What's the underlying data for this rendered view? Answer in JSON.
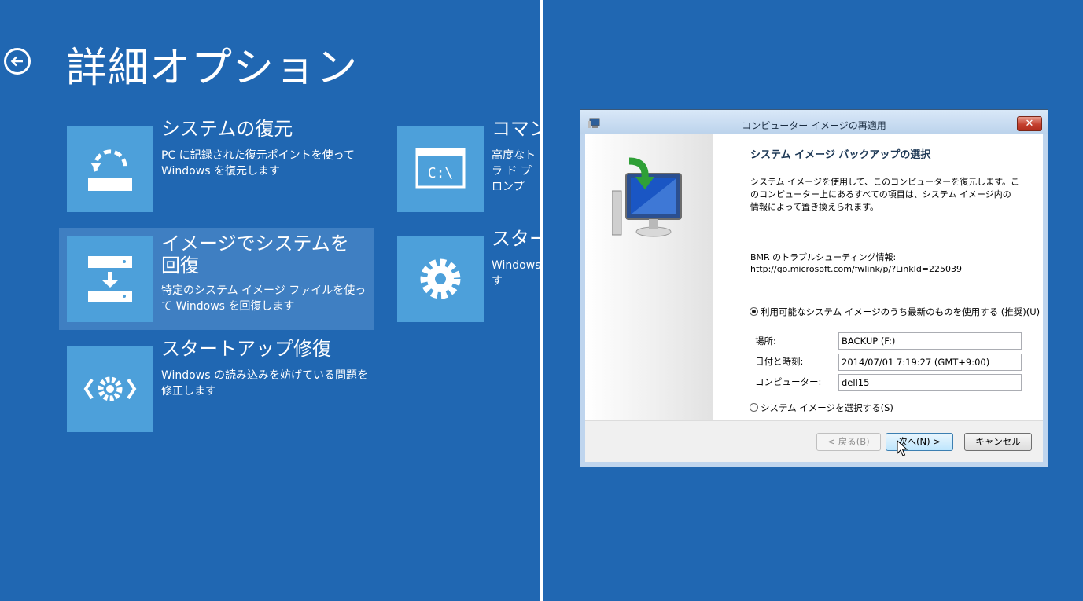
{
  "advanced_options": {
    "title": "詳細オプション",
    "options": [
      {
        "title": "システムの復元",
        "description": "PC に記録された復元ポイントを使って Windows を復元します",
        "icon": "system-restore-icon"
      },
      {
        "title": "イメージでシステムを回復",
        "description": "特定のシステム イメージ ファイルを使って Windows を回復します",
        "icon": "system-image-recovery-icon",
        "selected": true
      },
      {
        "title": "スタートアップ修復",
        "description": "Windows の読み込みを妨げている問題を修正します",
        "icon": "startup-repair-icon"
      },
      {
        "title": "コマン",
        "description": "高度なトラ ド プロンプ",
        "icon": "command-prompt-icon"
      },
      {
        "title": "スター",
        "description": "Windows す",
        "icon": "gear-icon"
      }
    ],
    "colors": {
      "background": "#2067b2",
      "tile": "#4da0da",
      "selected": "#3f7fc2"
    }
  },
  "dialog": {
    "title": "コンピューター イメージの再適用",
    "heading": "システム イメージ バックアップの選択",
    "description": "システム イメージを使用して、このコンピューターを復元します。このコンピューター上にあるすべての項目は、システム イメージ内の情報によって置き換えられます。",
    "bmr_label": "BMR のトラブルシューティング情報:",
    "bmr_link": "http://go.microsoft.com/fwlink/p/?LinkId=225039",
    "option_latest": "利用可能なシステム イメージのうち最新のものを使用する (推奨)(U)",
    "option_select": "システム イメージを選択する(S)",
    "fields": [
      {
        "label": "場所:",
        "value": "BACKUP (F:)"
      },
      {
        "label": "日付と時刻:",
        "value": "2014/07/01 7:19:27 (GMT+9:00)"
      },
      {
        "label": "コンピューター:",
        "value": "dell15"
      }
    ],
    "buttons": {
      "back": "< 戻る(B)",
      "next": "次へ(N) >",
      "cancel": "キャンセル"
    },
    "close_glyph": "✕"
  }
}
